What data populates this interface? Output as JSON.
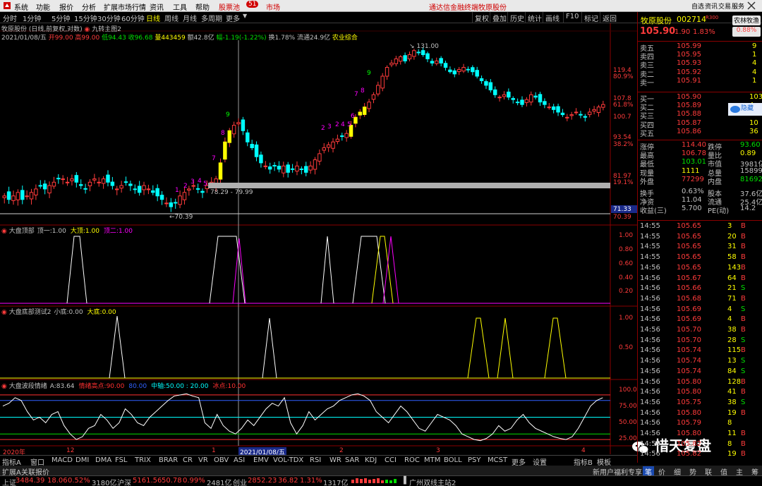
{
  "menu": {
    "items": [
      "系统",
      "功能",
      "报价",
      "分析",
      "扩展市场行情",
      "资讯",
      "工具",
      "帮助"
    ],
    "pool_label": "股票池",
    "pool_count": "51",
    "market_label": "市场",
    "broker_title": "通达信金融终端",
    "stock_title": "牧原股份"
  },
  "periods": {
    "items": [
      "分时",
      "1分钟",
      "5分钟",
      "15分钟",
      "30分钟",
      "60分钟",
      "日线",
      "周线",
      "月线",
      "多周期",
      "更多"
    ],
    "active_index": 6
  },
  "right_buttons": [
    "复权",
    "叠加",
    "历史",
    "统计",
    "画线",
    "F10",
    "标记",
    "返回"
  ],
  "chart_header": {
    "line1": "牧原股份 (日线,前复权,对数)",
    "indicator": "九转主图2",
    "date": "2021/01/08/五",
    "open": "开99.00",
    "high": "高99.00",
    "low": "低94.43",
    "close": "收96.68",
    "volume": "量443459",
    "amount": "额42.8亿",
    "change": "幅-1.19(-1.22%)",
    "turnover": "换1.78%",
    "float": "流通24.9亿",
    "sector": "农业综合"
  },
  "price_axis": [
    "119.4",
    "80.9%",
    "107.8",
    "61.8%",
    "100.7",
    "93.54",
    "38.2%",
    "81.97",
    "19.1%",
    "71.33",
    "70.39"
  ],
  "annotations": {
    "high_label": "131.00",
    "low_label": "70.39",
    "range_label": "78.29 - 79.99",
    "nine_turn_counts": [
      "1",
      "2",
      "3",
      "4",
      "5",
      "7",
      "8",
      "9",
      "2",
      "3",
      "2",
      "4",
      "5",
      "6",
      "7",
      "8",
      "9"
    ]
  },
  "panels": [
    {
      "title": "大盘顶部",
      "items": [
        {
          "label": "顶一:",
          "value": "1.00",
          "color": "#c0c0c0"
        },
        {
          "label": "大顶:",
          "value": "1.00",
          "color": "#ffff00"
        },
        {
          "label": "顶二:",
          "value": "1.00",
          "color": "#ff00ff"
        }
      ],
      "axis": [
        "1.00",
        "0.80",
        "0.60",
        "0.40",
        "0.20"
      ]
    },
    {
      "title": "大盘底部测试2",
      "items": [
        {
          "label": "小底:",
          "value": "0.00",
          "color": "#c0c0c0"
        },
        {
          "label": "大底:",
          "value": "0.00",
          "color": "#ffff00"
        }
      ],
      "axis": [
        "1.00",
        "0.50"
      ]
    },
    {
      "title": "大盘波段情绪",
      "items": [
        {
          "label": "A:",
          "value": "83.64",
          "color": "#c0c0c0"
        },
        {
          "label": "情绪高点:",
          "value": "90.00",
          "color": "#ff3030"
        },
        {
          "label": "",
          "value": "80.00",
          "color": "#3060ff"
        },
        {
          "label": "中轴:",
          "value": "50.00 : 20.00",
          "color": "#00ffff"
        },
        {
          "label": "冰点:",
          "value": "10.00",
          "color": "#ff3030"
        }
      ],
      "axis": [
        "100.0",
        "75.00",
        "50.00",
        "25.00"
      ]
    }
  ],
  "date_axis": [
    "2020年",
    "12",
    "1",
    "2021/01/08/五",
    "2",
    "3",
    "4"
  ],
  "bottom_tabs": [
    "指标A",
    "窗口",
    "MACD",
    "DMI",
    "DMA",
    "FSL",
    "TRIX",
    "BRAR",
    "CR",
    "VR",
    "OBV",
    "ASI",
    "EMV",
    "VOL-TDX",
    "RSI",
    "WR",
    "SAR",
    "KDJ",
    "CCI",
    "ROC",
    "MTM",
    "BOLL",
    "PSY",
    "MCST",
    "更多",
    "设置"
  ],
  "bottom_tabs_right": [
    "指标B",
    "模板"
  ],
  "bottom2": [
    "扩展A",
    "关联报价"
  ],
  "bottom2_right": [
    "新用户福利专享",
    "笔",
    "价",
    "细",
    "势",
    "联",
    "值",
    "主",
    "筹"
  ],
  "quote": {
    "name": "牧原股份",
    "code": "002714",
    "rank": "R300",
    "tag": "农林牧渔",
    "price": "105.90",
    "change": "1.90",
    "pct": "1.83%",
    "sector_pct": "0.88%",
    "asks": [
      {
        "label": "卖五",
        "price": "105.99",
        "vol": "9"
      },
      {
        "label": "卖四",
        "price": "105.95",
        "vol": "1"
      },
      {
        "label": "卖三",
        "price": "105.93",
        "vol": "4"
      },
      {
        "label": "卖二",
        "price": "105.92",
        "vol": "4"
      },
      {
        "label": "卖一",
        "price": "105.91",
        "vol": "1"
      }
    ],
    "bids": [
      {
        "label": "买一",
        "price": "105.90",
        "vol": "103"
      },
      {
        "label": "买二",
        "price": "105.89",
        "vol": "4"
      },
      {
        "label": "买三",
        "price": "105.88",
        "vol": "1"
      },
      {
        "label": "买四",
        "price": "105.87",
        "vol": "10"
      },
      {
        "label": "买五",
        "price": "105.86",
        "vol": "36"
      }
    ],
    "stats": [
      {
        "l1": "涨停",
        "v1": "114.40",
        "c1": "#ff3b3b",
        "l2": "跌停",
        "v2": "93.60",
        "c2": "#00e000"
      },
      {
        "l1": "最高",
        "v1": "106.78",
        "c1": "#ff3b3b",
        "l2": "量比",
        "v2": "0.89",
        "c2": "#ffff00"
      },
      {
        "l1": "最低",
        "v1": "103.01",
        "c1": "#00e000",
        "l2": "市值",
        "v2": "3981亿",
        "c2": "#c0c0c0"
      },
      {
        "l1": "现量",
        "v1": "1111",
        "c1": "#ffff00",
        "l2": "总量",
        "v2": "158991",
        "c2": "#c0c0c0"
      },
      {
        "l1": "外盘",
        "v1": "77299",
        "c1": "#ff3b3b",
        "l2": "内盘",
        "v2": "81692",
        "c2": "#00e000"
      },
      {
        "l1": "换手",
        "v1": "0.63%",
        "c1": "#c0c0c0",
        "l2": "股本",
        "v2": "37.6亿",
        "c2": "#c0c0c0"
      },
      {
        "l1": "净资",
        "v1": "11.04",
        "c1": "#c0c0c0",
        "l2": "流通",
        "v2": "25.4亿",
        "c2": "#c0c0c0"
      },
      {
        "l1": "收益(三)",
        "v1": "5.700",
        "c1": "#c0c0c0",
        "l2": "PE(动)",
        "v2": "14.2",
        "c2": "#c0c0c0"
      }
    ],
    "ticks": [
      {
        "t": "14:55",
        "p": "105.65",
        "v": "3",
        "d": "B"
      },
      {
        "t": "14:55",
        "p": "105.65",
        "v": "20",
        "d": "B"
      },
      {
        "t": "14:55",
        "p": "105.65",
        "v": "31",
        "d": "B"
      },
      {
        "t": "14:55",
        "p": "105.65",
        "v": "58",
        "d": "B"
      },
      {
        "t": "14:56",
        "p": "105.65",
        "v": "143",
        "d": "B"
      },
      {
        "t": "14:56",
        "p": "105.67",
        "v": "64",
        "d": "B"
      },
      {
        "t": "14:56",
        "p": "105.66",
        "v": "21",
        "d": "S"
      },
      {
        "t": "14:56",
        "p": "105.68",
        "v": "71",
        "d": "B"
      },
      {
        "t": "14:56",
        "p": "105.69",
        "v": "4",
        "d": "S"
      },
      {
        "t": "14:56",
        "p": "105.69",
        "v": "4",
        "d": "B"
      },
      {
        "t": "14:56",
        "p": "105.70",
        "v": "38",
        "d": "B"
      },
      {
        "t": "14:56",
        "p": "105.70",
        "v": "28",
        "d": "S"
      },
      {
        "t": "14:56",
        "p": "105.74",
        "v": "115",
        "d": "B"
      },
      {
        "t": "14:56",
        "p": "105.74",
        "v": "13",
        "d": "S"
      },
      {
        "t": "14:56",
        "p": "105.74",
        "v": "84",
        "d": "S"
      },
      {
        "t": "14:56",
        "p": "105.80",
        "v": "128",
        "d": "B"
      },
      {
        "t": "14:56",
        "p": "105.80",
        "v": "41",
        "d": "B"
      },
      {
        "t": "14:56",
        "p": "105.75",
        "v": "38",
        "d": "S"
      },
      {
        "t": "14:56",
        "p": "105.80",
        "v": "19",
        "d": "B"
      },
      {
        "t": "14:56",
        "p": "105.79",
        "v": "8",
        "d": ""
      },
      {
        "t": "14:56",
        "p": "105.80",
        "v": "11",
        "d": "B"
      },
      {
        "t": "14:56",
        "p": "105.82",
        "v": "8",
        "d": "B"
      },
      {
        "t": "14:56",
        "p": "105.82",
        "v": "19",
        "d": "B"
      }
    ],
    "side_labels": [
      "自选",
      "资讯",
      "交易",
      "服务"
    ],
    "fold_label": "隐藏"
  },
  "status": {
    "sh_label": "上证",
    "sh_val": "3484.39",
    "sh_chg": "18.06",
    "sh_pct": "0.52%",
    "sh_amt": "3180亿",
    "sz_label": "沪深",
    "sz_val": "5161.56",
    "sz_chg": "50.78",
    "sz_pct": "0.99%",
    "sz_amt": "2481亿",
    "cy_label": "创业",
    "cy_val": "2852.23",
    "cy_chg": "36.82",
    "cy_pct": "1.31%",
    "cy_amt": "1317亿",
    "server": "广州双线主站2"
  },
  "watermark": "惜天复盘",
  "colors": {
    "up": "#ff3b3b",
    "down": "#00ffff",
    "axis_red": "#8a0000",
    "yellow": "#ffff00"
  }
}
